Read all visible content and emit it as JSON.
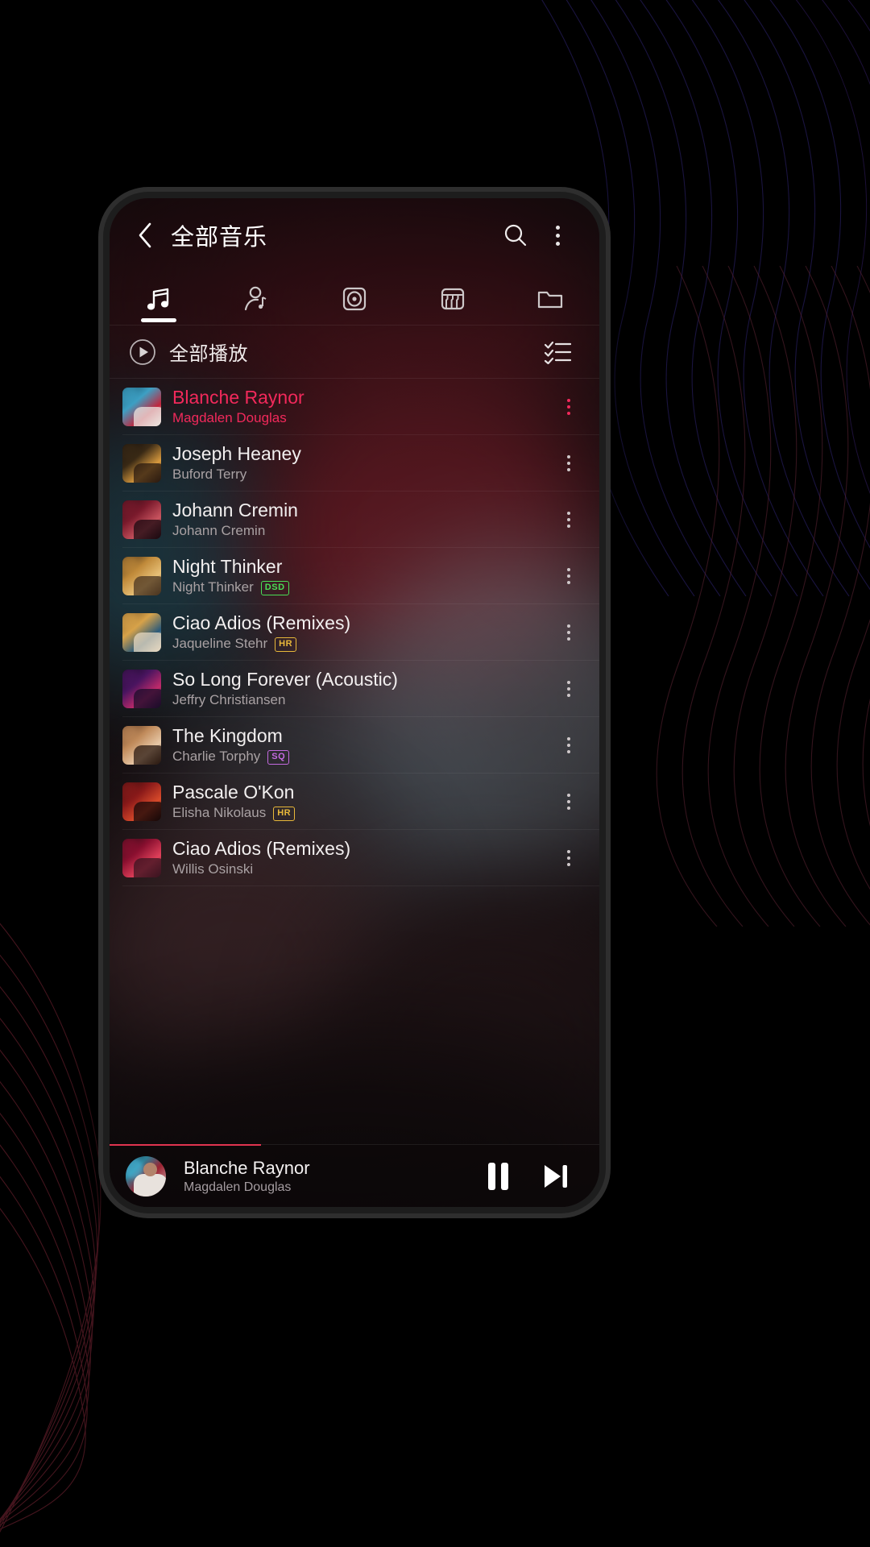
{
  "app": {
    "header": {
      "back_icon": "chevron-left-icon",
      "title": "全部音乐",
      "search_icon": "search-icon",
      "overflow_icon": "kebab-menu-icon"
    },
    "tabs": [
      {
        "name": "songs",
        "icon": "music-note-icon",
        "active": true
      },
      {
        "name": "artists",
        "icon": "artist-icon",
        "active": false
      },
      {
        "name": "albums",
        "icon": "album-disc-icon",
        "active": false
      },
      {
        "name": "genres",
        "icon": "piano-keys-icon",
        "active": false
      },
      {
        "name": "folders",
        "icon": "folder-icon",
        "active": false
      }
    ],
    "play_all": {
      "icon": "play-circle-icon",
      "label": "全部播放",
      "multiselect_icon": "checklist-icon"
    },
    "songs": [
      {
        "title": "Blanche Raynor",
        "artist": "Magdalen Douglas",
        "badge": "",
        "playing": true
      },
      {
        "title": "Joseph Heaney",
        "artist": "Buford Terry",
        "badge": "",
        "playing": false
      },
      {
        "title": "Johann Cremin",
        "artist": "Johann Cremin",
        "badge": "",
        "playing": false
      },
      {
        "title": "Night Thinker",
        "artist": "Night Thinker",
        "badge": "DSD",
        "playing": false
      },
      {
        "title": "Ciao Adios (Remixes)",
        "artist": "Jaqueline Stehr",
        "badge": "HR",
        "playing": false
      },
      {
        "title": "So Long Forever (Acoustic)",
        "artist": "Jeffry Christiansen",
        "badge": "",
        "playing": false
      },
      {
        "title": "The Kingdom",
        "artist": "Charlie Torphy",
        "badge": "SQ",
        "playing": false
      },
      {
        "title": "Pascale O'Kon",
        "artist": "Elisha Nikolaus",
        "badge": "HR",
        "playing": false
      },
      {
        "title": "Ciao Adios (Remixes)",
        "artist": "Willis Osinski",
        "badge": "",
        "playing": false
      }
    ],
    "mini_player": {
      "title": "Blanche Raynor",
      "artist": "Magdalen Douglas",
      "pause_icon": "pause-icon",
      "next_icon": "skip-next-icon"
    },
    "colors": {
      "accent": "#f2295b",
      "badge_dsd": "#4ade55",
      "badge_hr": "#e8b83a",
      "badge_sq": "#c46ae0",
      "progress": "#e0344f"
    }
  }
}
